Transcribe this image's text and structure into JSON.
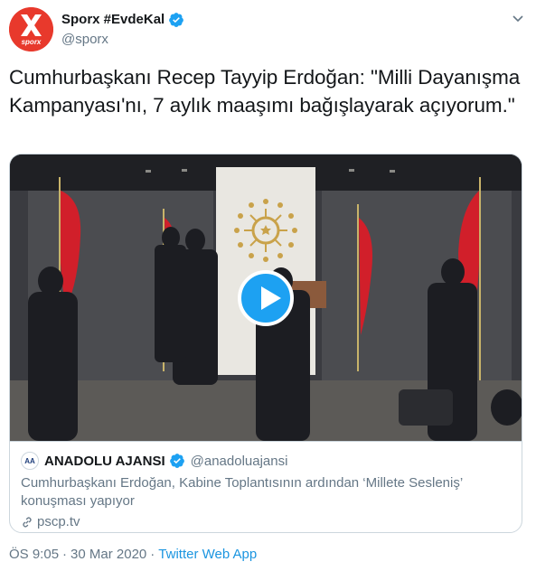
{
  "author": {
    "display_name": "Sporx #EvdeKal",
    "handle": "@sporx",
    "avatar_text": "sporx",
    "verified_icon": "verified-badge-icon",
    "brand_color": "#e8392c"
  },
  "tweet": {
    "text": "Cumhurbaşkanı Recep Tayyip Erdoğan: \"Milli Dayanışma Kampanyası'nı, 7 aylık maaşımı bağışlayarak açıyorum.\""
  },
  "card": {
    "play_icon": "play-icon",
    "source_name": "ANADOLU AJANSI",
    "source_handle": "@anadoluajansi",
    "source_logo_text": "AA",
    "description": "Cumhurbaşkanı Erdoğan, Kabine Toplantısının ardından ‘Millete Sesleniş’ konuşması yapıyor",
    "link_text": "pscp.tv"
  },
  "footer": {
    "time": "ÖS 9:05",
    "separator": "·",
    "date": "30 Mar 2020",
    "app": "Twitter Web App"
  },
  "colors": {
    "accent": "#1da1f2",
    "link": "#1b95e0",
    "secondary_text": "#657786",
    "border": "#ccd6dd"
  }
}
